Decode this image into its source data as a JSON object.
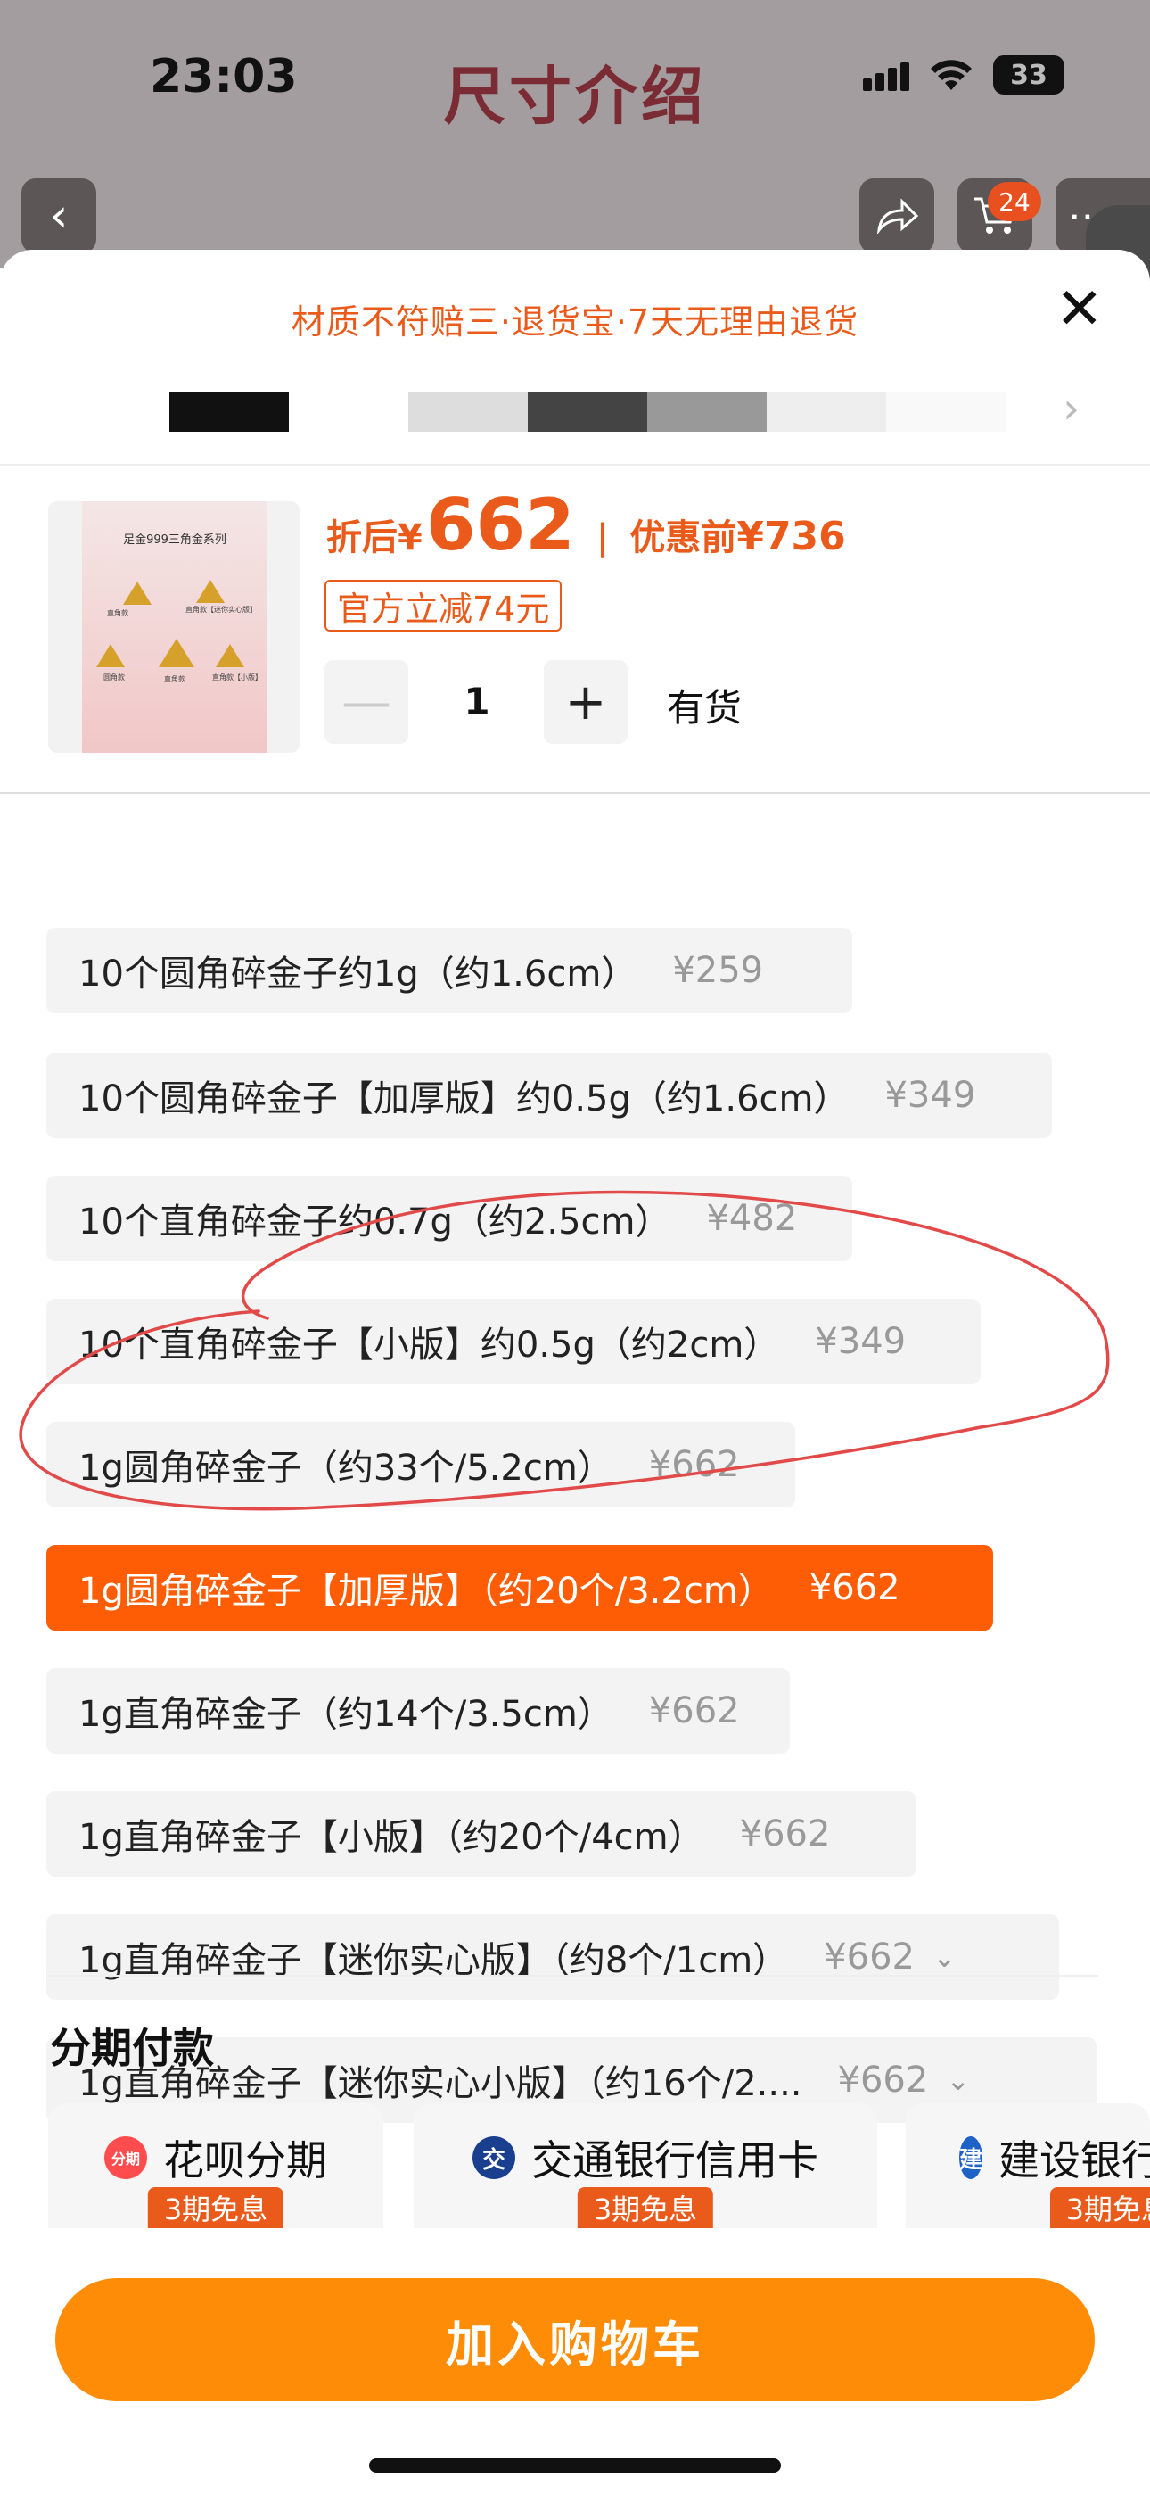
{
  "status_bar": {
    "time": "23:03",
    "battery": "33"
  },
  "nav": {
    "title": "尺寸介绍",
    "back_icon": "‹",
    "cart_badge": "24"
  },
  "sheet": {
    "guarantee": "材质不符赔三·退货宝·7天无理由退货",
    "thumb_colors": [
      "#111111",
      "#ffffff",
      "#dddddd",
      "#444444",
      "#999999",
      "#eeeeee",
      "#f9f9f9"
    ]
  },
  "product": {
    "image_title": "足金999三角金系列",
    "image_labels": [
      "直角款",
      "直角款【迷你实心版】",
      "直角款【迷你实心版】",
      "圆角款",
      "直角款",
      "直角款【小版】"
    ],
    "after_label": "折后",
    "currency": "¥",
    "price": "662",
    "separator": "|",
    "before_label": "优惠前",
    "original_price": "¥736",
    "discount_tag": "官方立减74元",
    "qty_minus": "—",
    "quantity": "1",
    "qty_plus": "+",
    "stock": "有货"
  },
  "options": [
    {
      "label": "10个圆角碎金子约1g（约1.6cm）",
      "price": "¥259",
      "selected": false,
      "dropdown": false
    },
    {
      "label": "10个圆角碎金子【加厚版】约0.5g（约1.6cm）",
      "price": "¥349",
      "selected": false,
      "dropdown": false
    },
    {
      "label": "10个直角碎金子约0.7g（约2.5cm）",
      "price": "¥482",
      "selected": false,
      "dropdown": false
    },
    {
      "label": "10个直角碎金子【小版】约0.5g（约2cm）",
      "price": "¥349",
      "selected": false,
      "dropdown": false
    },
    {
      "label": "1g圆角碎金子（约33个/5.2cm）",
      "price": "¥662",
      "selected": false,
      "dropdown": false
    },
    {
      "label": "1g圆角碎金子【加厚版】（约20个/3.2cm）",
      "price": "¥662",
      "selected": true,
      "dropdown": false
    },
    {
      "label": "1g直角碎金子（约14个/3.5cm）",
      "price": "¥662",
      "selected": false,
      "dropdown": false
    },
    {
      "label": "1g直角碎金子【小版】（约20个/4cm）",
      "price": "¥662",
      "selected": false,
      "dropdown": false
    },
    {
      "label": "1g直角碎金子【迷你实心版】（约8个/1cm）",
      "price": "¥662",
      "selected": false,
      "dropdown": true
    },
    {
      "label": "1g直角碎金子【迷你实心小版】（约16个/2....",
      "price": "¥662",
      "selected": false,
      "dropdown": true
    }
  ],
  "installment": {
    "title": "分期付款",
    "cards": [
      {
        "name": "花呗分期",
        "tag": "3期免息",
        "icon": "huabei-icon",
        "icon_text": "分期",
        "icon_color": "#ff4d4f"
      },
      {
        "name": "交通银行信用卡",
        "tag": "3期免息",
        "icon": "bocom-icon",
        "icon_text": "交",
        "icon_color": "#1a3f8f"
      },
      {
        "name": "建设银行信用卡",
        "tag": "3期免息",
        "icon": "ccb-icon",
        "icon_text": "建",
        "icon_color": "#1e62c8"
      }
    ]
  },
  "cta": {
    "add_to_cart": "加入购物车"
  },
  "annotation": {
    "color": "#e24a4a"
  }
}
